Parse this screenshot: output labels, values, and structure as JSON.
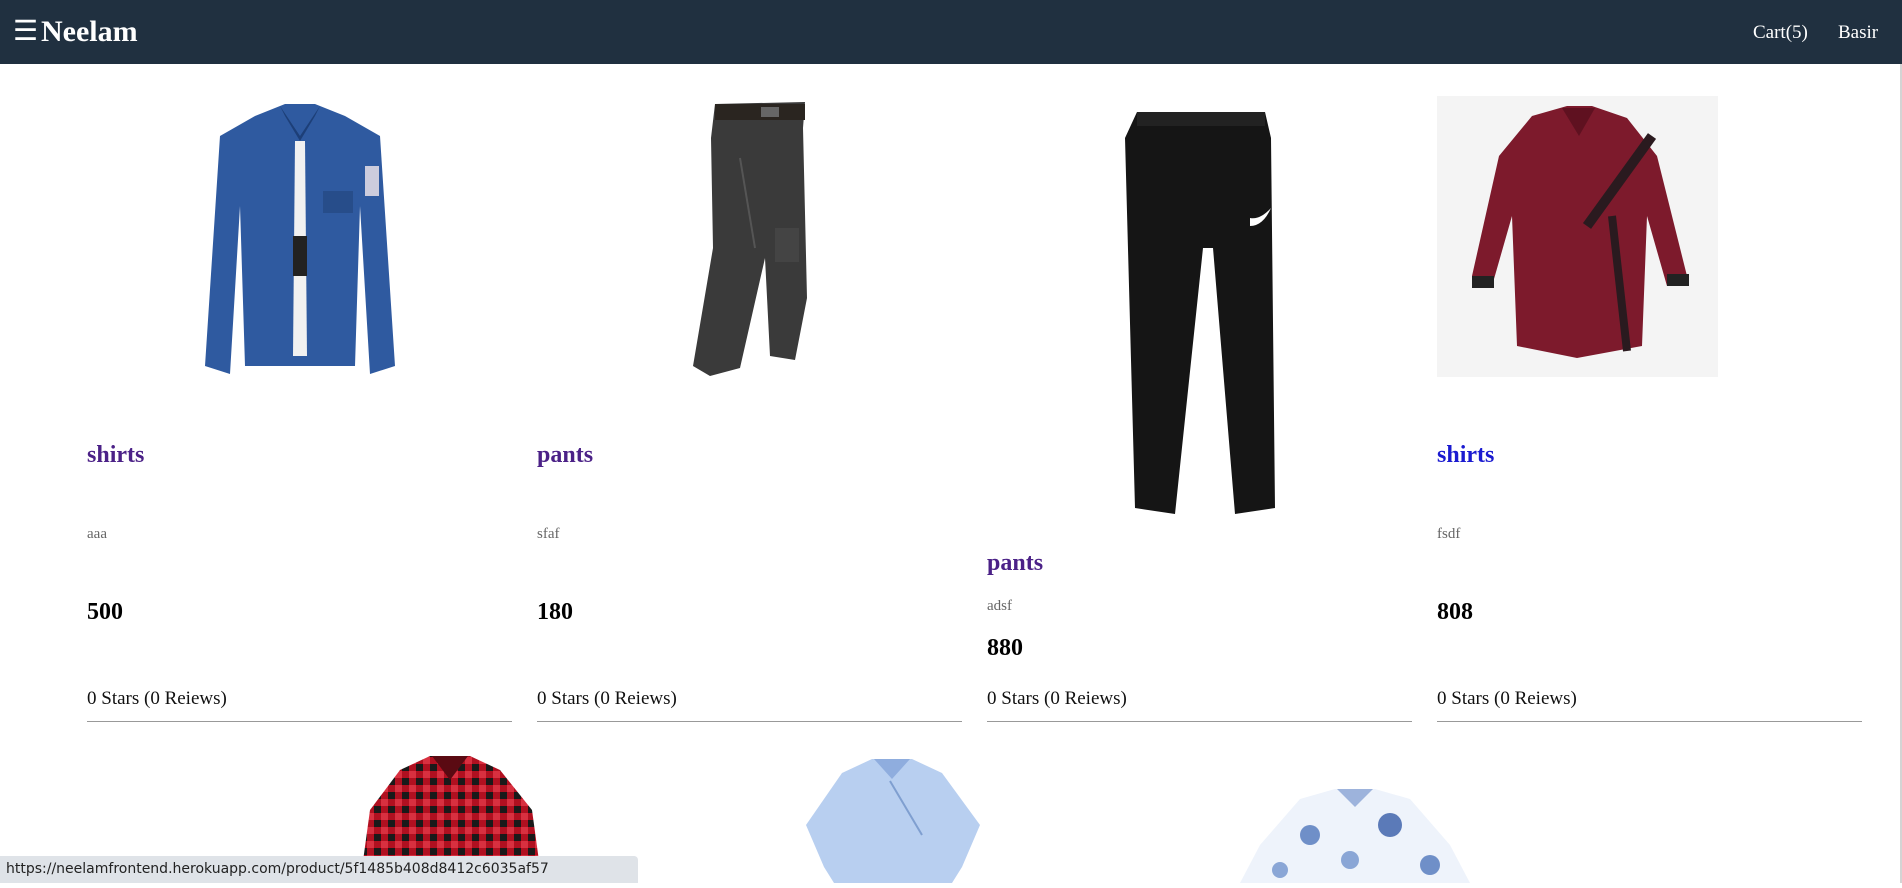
{
  "header": {
    "menu_icon": "☰",
    "brand": "Neelam",
    "cart_label": "Cart(5)",
    "user_label": "Basir"
  },
  "products": [
    {
      "name": "shirts",
      "brand": "aaa",
      "price": "500",
      "rating": "0 Stars (0 Reiews)",
      "image": "blue-denim-shirt"
    },
    {
      "name": "pants",
      "brand": "sfaf",
      "price": "180",
      "rating": "0 Stars (0 Reiews)",
      "image": "grey-cargo-pants"
    },
    {
      "name": "pants",
      "brand": "adsf",
      "price": "880",
      "rating": "0 Stars (0 Reiews)",
      "image": "black-track-pants"
    },
    {
      "name": "shirts",
      "brand": "fsdf",
      "price": "808",
      "rating": "0 Stars (0 Reiews)",
      "image": "maroon-shirt"
    }
  ],
  "next_row_images": [
    "red-check-shirt",
    "light-blue-shirt",
    "floral-shirt"
  ],
  "status_bar": {
    "url": "https://neelamfrontend.herokuapp.com/product/5f1485b408d8412c6035af57"
  },
  "colors": {
    "header_bg": "#203040",
    "visited_link": "#4b2187",
    "link": "#1a1ad0"
  }
}
